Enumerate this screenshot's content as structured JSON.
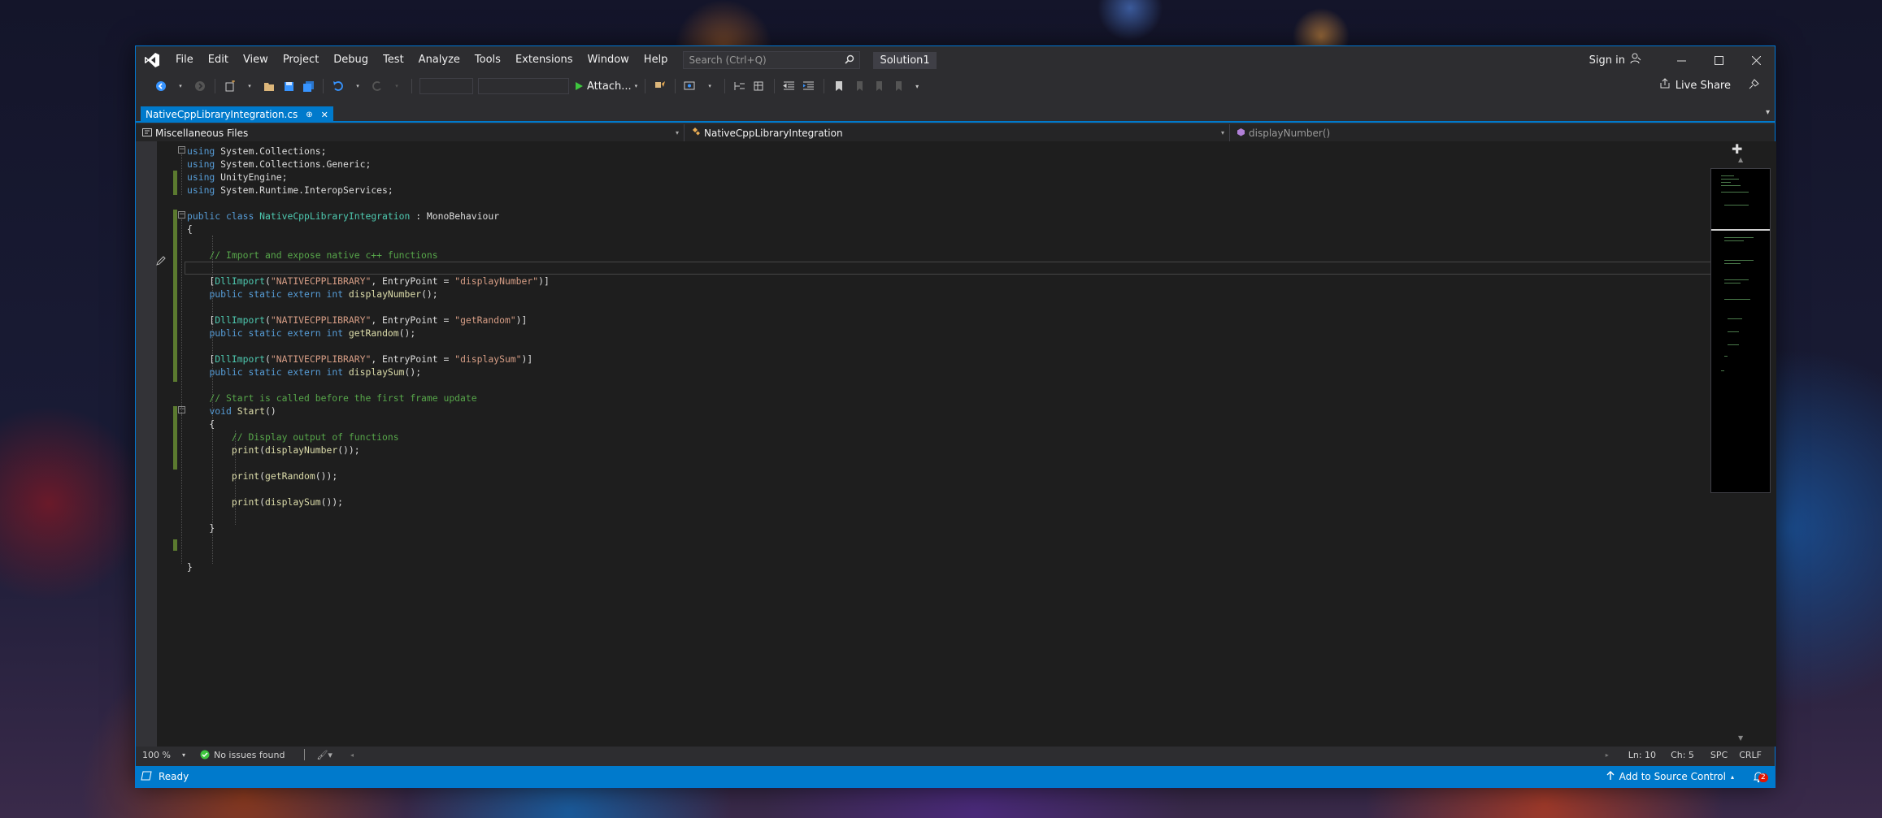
{
  "title_bar": {
    "menu": [
      "File",
      "Edit",
      "View",
      "Project",
      "Debug",
      "Test",
      "Analyze",
      "Tools",
      "Extensions",
      "Window",
      "Help"
    ],
    "search_placeholder": "Search (Ctrl+Q)",
    "solution_name": "Solution1",
    "sign_in": "Sign in"
  },
  "toolbar": {
    "attach_label": "Attach...",
    "live_share": "Live Share"
  },
  "tab": {
    "filename": "NativeCppLibraryIntegration.cs",
    "pin": "⊕",
    "close": "✕"
  },
  "navbar": {
    "project": "Miscellaneous Files",
    "class": "NativeCppLibraryIntegration",
    "member": "displayNumber()"
  },
  "code_lines": [
    [
      [
        "kw",
        "using"
      ],
      [
        "pl",
        " System.Collections;"
      ]
    ],
    [
      [
        "kw",
        "using"
      ],
      [
        "pl",
        " System.Collections.Generic;"
      ]
    ],
    [
      [
        "kw",
        "using"
      ],
      [
        "pl",
        " UnityEngine;"
      ]
    ],
    [
      [
        "kw",
        "using"
      ],
      [
        "pl",
        " System.Runtime.InteropServices;"
      ]
    ],
    [],
    [
      [
        "kw",
        "public"
      ],
      [
        "pl",
        " "
      ],
      [
        "kw",
        "class"
      ],
      [
        "pl",
        " "
      ],
      [
        "ty",
        "NativeCppLibraryIntegration"
      ],
      [
        "pl",
        " : MonoBehaviour"
      ]
    ],
    [
      [
        "pl",
        "{"
      ]
    ],
    [],
    [
      [
        "pl",
        "    "
      ],
      [
        "cm",
        "// Import and expose native c++ functions"
      ]
    ],
    [],
    [
      [
        "pl",
        "    ["
      ],
      [
        "ty",
        "DllImport"
      ],
      [
        "pl",
        "("
      ],
      [
        "str",
        "\"NATIVECPPLIBRARY\""
      ],
      [
        "pl",
        ", EntryPoint = "
      ],
      [
        "str",
        "\"displayNumber\""
      ],
      [
        "pl",
        ")]"
      ]
    ],
    [
      [
        "pl",
        "    "
      ],
      [
        "kw",
        "public"
      ],
      [
        "pl",
        " "
      ],
      [
        "kw",
        "static"
      ],
      [
        "pl",
        " "
      ],
      [
        "kw",
        "extern"
      ],
      [
        "pl",
        " "
      ],
      [
        "kw",
        "int"
      ],
      [
        "pl",
        " "
      ],
      [
        "fn",
        "displayNumber"
      ],
      [
        "pl",
        "();"
      ]
    ],
    [],
    [
      [
        "pl",
        "    ["
      ],
      [
        "ty",
        "DllImport"
      ],
      [
        "pl",
        "("
      ],
      [
        "str",
        "\"NATIVECPPLIBRARY\""
      ],
      [
        "pl",
        ", EntryPoint = "
      ],
      [
        "str",
        "\"getRandom\""
      ],
      [
        "pl",
        ")]"
      ]
    ],
    [
      [
        "pl",
        "    "
      ],
      [
        "kw",
        "public"
      ],
      [
        "pl",
        " "
      ],
      [
        "kw",
        "static"
      ],
      [
        "pl",
        " "
      ],
      [
        "kw",
        "extern"
      ],
      [
        "pl",
        " "
      ],
      [
        "kw",
        "int"
      ],
      [
        "pl",
        " "
      ],
      [
        "fn",
        "getRandom"
      ],
      [
        "pl",
        "();"
      ]
    ],
    [],
    [
      [
        "pl",
        "    ["
      ],
      [
        "ty",
        "DllImport"
      ],
      [
        "pl",
        "("
      ],
      [
        "str",
        "\"NATIVECPPLIBRARY\""
      ],
      [
        "pl",
        ", EntryPoint = "
      ],
      [
        "str",
        "\"displaySum\""
      ],
      [
        "pl",
        ")]"
      ]
    ],
    [
      [
        "pl",
        "    "
      ],
      [
        "kw",
        "public"
      ],
      [
        "pl",
        " "
      ],
      [
        "kw",
        "static"
      ],
      [
        "pl",
        " "
      ],
      [
        "kw",
        "extern"
      ],
      [
        "pl",
        " "
      ],
      [
        "kw",
        "int"
      ],
      [
        "pl",
        " "
      ],
      [
        "fn",
        "displaySum"
      ],
      [
        "pl",
        "();"
      ]
    ],
    [],
    [
      [
        "pl",
        "    "
      ],
      [
        "cm",
        "// Start is called before the first frame update"
      ]
    ],
    [
      [
        "pl",
        "    "
      ],
      [
        "kw",
        "void"
      ],
      [
        "pl",
        " "
      ],
      [
        "fn",
        "Start"
      ],
      [
        "pl",
        "()"
      ]
    ],
    [
      [
        "pl",
        "    {"
      ]
    ],
    [
      [
        "pl",
        "        "
      ],
      [
        "cm",
        "// Display output of functions"
      ]
    ],
    [
      [
        "pl",
        "        "
      ],
      [
        "fn",
        "print"
      ],
      [
        "pl",
        "("
      ],
      [
        "fn",
        "displayNumber"
      ],
      [
        "pl",
        "());"
      ]
    ],
    [],
    [
      [
        "pl",
        "        "
      ],
      [
        "fn",
        "print"
      ],
      [
        "pl",
        "("
      ],
      [
        "fn",
        "getRandom"
      ],
      [
        "pl",
        "());"
      ]
    ],
    [],
    [
      [
        "pl",
        "        "
      ],
      [
        "fn",
        "print"
      ],
      [
        "pl",
        "("
      ],
      [
        "fn",
        "displaySum"
      ],
      [
        "pl",
        "());"
      ]
    ],
    [],
    [
      [
        "pl",
        "    }"
      ]
    ],
    [],
    [],
    [
      [
        "pl",
        "}"
      ]
    ]
  ],
  "editor_status": {
    "zoom": "100 %",
    "issues": "No issues found",
    "line": "Ln: 10",
    "col": "Ch: 5",
    "whitespace": "SPC",
    "line_ending": "CRLF"
  },
  "status_bar": {
    "ready": "Ready",
    "source_control": "Add to Source Control",
    "notifications": "2"
  },
  "colors": {
    "accent": "#007acc",
    "keyword": "#569cd6",
    "type": "#4ec9b0",
    "method": "#dcdcaa",
    "string": "#d69d85",
    "comment": "#57a64a"
  }
}
